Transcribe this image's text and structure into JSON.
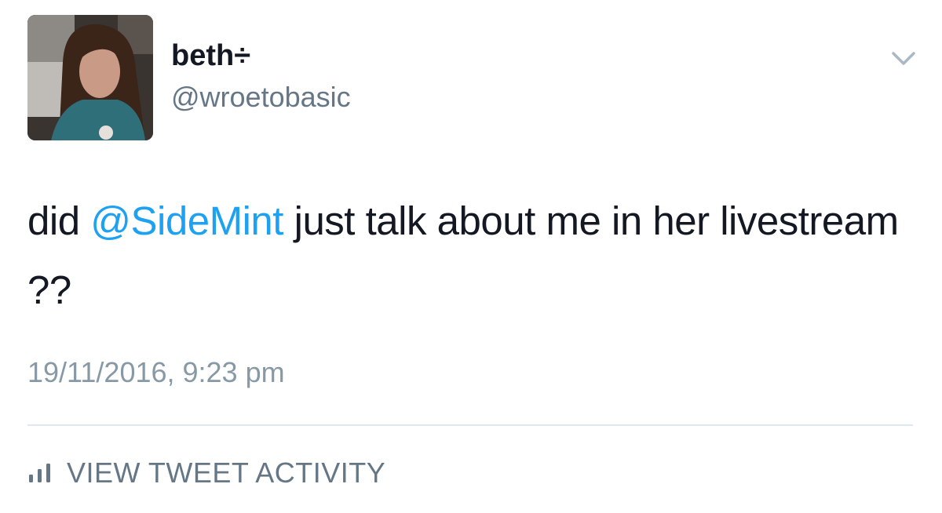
{
  "tweet": {
    "author": {
      "display_name": "beth÷",
      "handle": "@wroetobasic"
    },
    "text": {
      "prefix": "did ",
      "mention": "@SideMint",
      "suffix": " just talk about me in her livestream ??"
    },
    "timestamp": "19/11/2016, 9:23 pm",
    "activity_label": "VIEW TWEET ACTIVITY"
  },
  "icons": {
    "menu": "chevron-down-icon",
    "activity": "bar-chart-icon"
  },
  "colors": {
    "mention": "#1da1f2",
    "text": "#141823",
    "secondary": "#657786",
    "timestamp": "#8899a6",
    "divider": "#e1e8ed"
  }
}
